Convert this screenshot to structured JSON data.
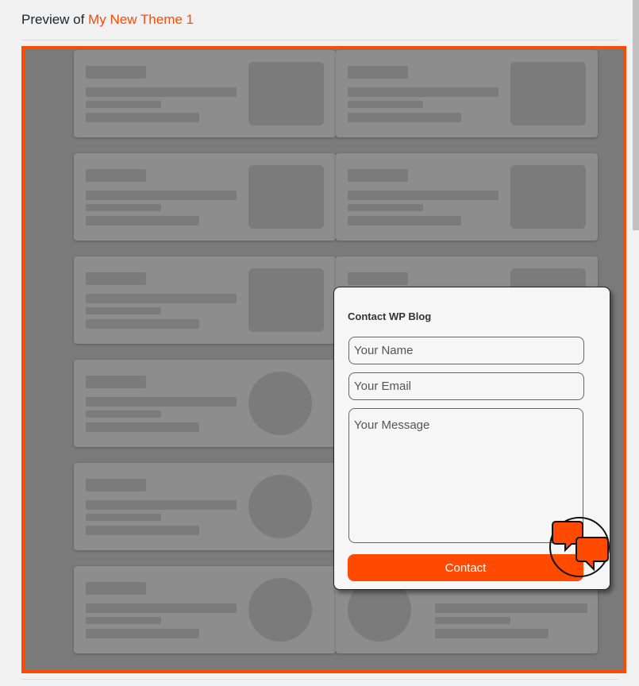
{
  "header": {
    "prefix": "Preview of",
    "theme_name": "My New Theme 1"
  },
  "colors": {
    "accent": "#ff4a00",
    "overlay": "#7a7a7a",
    "card": "#8d8d8d",
    "skeleton": "#7b7b7b"
  },
  "preview": {
    "cards": [
      {
        "variant": "thumb"
      },
      {
        "variant": "thumb"
      },
      {
        "variant": "thumb"
      },
      {
        "variant": "thumb"
      },
      {
        "variant": "thumb"
      },
      {
        "variant": "thumb"
      },
      {
        "variant": "circle"
      },
      {
        "variant": "circle"
      },
      {
        "variant": "circle"
      },
      {
        "variant": "circle-left"
      }
    ]
  },
  "contact_form": {
    "title": "Contact WP Blog",
    "name_placeholder": "Your Name",
    "email_placeholder": "Your Email",
    "message_placeholder": "Your Message",
    "submit_label": "Contact"
  },
  "chat_launcher": {
    "icon": "chat-bubbles-icon"
  }
}
